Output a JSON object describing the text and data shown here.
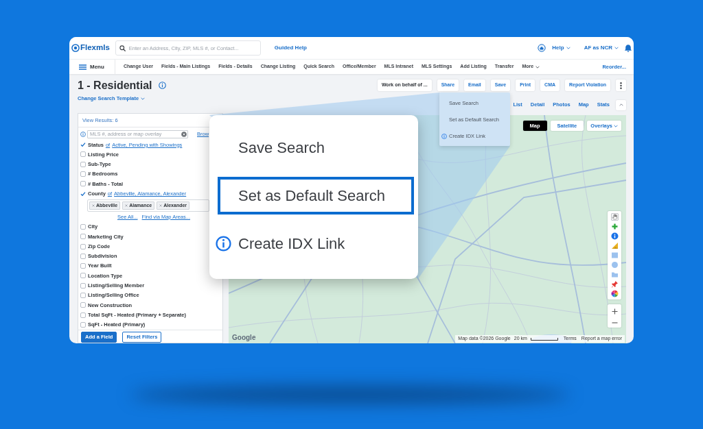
{
  "header": {
    "logo": "Flexmls",
    "search": {
      "placeholder": "Enter an Address, City, ZIP, MLS #, or Contact..."
    },
    "guided_help": "Guided Help",
    "help_menu": "Help",
    "user_menu": "AF as NCR"
  },
  "nav": {
    "menu": "Menu",
    "items": [
      {
        "label": "Change User",
        "kind": "link"
      },
      {
        "label": "Fields - Main Listings",
        "kind": "link"
      },
      {
        "label": "Fields - Details",
        "kind": "link"
      },
      {
        "label": "Change Listing",
        "kind": "link"
      },
      {
        "label": "Quick Search",
        "kind": "link"
      },
      {
        "label": "Office/Member",
        "kind": "link"
      },
      {
        "label": "MLS Intranet",
        "kind": "link"
      },
      {
        "label": "MLS Settings",
        "kind": "link"
      },
      {
        "label": "Add Listing",
        "kind": "link"
      },
      {
        "label": "Transfer",
        "kind": "link"
      },
      {
        "label": "More",
        "kind": "dropdown"
      }
    ],
    "reorder": "Reorder..."
  },
  "page": {
    "title": "1 - Residential",
    "template_link": "Change Search Template"
  },
  "toolbar": [
    {
      "label": "Work on behalf of ...",
      "kind": "neutral"
    },
    {
      "label": "Share",
      "kind": "action"
    },
    {
      "label": "Email",
      "kind": "action"
    },
    {
      "label": "Save",
      "kind": "action"
    },
    {
      "label": "Print",
      "kind": "action"
    },
    {
      "label": "CMA",
      "kind": "action"
    },
    {
      "label": "Report Violation",
      "kind": "action"
    }
  ],
  "view_tabs": [
    "List",
    "Detail",
    "Photos",
    "Map",
    "Stats"
  ],
  "dropdown_menu": [
    {
      "label": "Save Search",
      "kind": "plain"
    },
    {
      "label": "Set as Default Search",
      "kind": "plain"
    },
    {
      "label": "Create IDX Link",
      "kind": "info"
    }
  ],
  "filters": {
    "results": "View Results: 6",
    "search": {
      "placeholder": "MLS #, address or map overlay"
    },
    "browse_link": "Brow",
    "fields": [
      {
        "label": "Status",
        "checked": true,
        "qualifier": "of",
        "value": "Active, Pending with Showings"
      },
      {
        "label": "Listing Price",
        "checked": false
      },
      {
        "label": "Sub-Type",
        "checked": false
      },
      {
        "label": "# Bedrooms",
        "checked": false
      },
      {
        "label": "# Baths - Total",
        "checked": false
      },
      {
        "label": "County",
        "checked": true,
        "qualifier": "of",
        "value": "Abbeville, Alamance, Alexander",
        "chips": [
          "Abbeville",
          "Alamance",
          "Alexander"
        ],
        "links": [
          "See All...",
          "Find via Map Areas..."
        ]
      },
      {
        "label": "City",
        "checked": false
      },
      {
        "label": "Marketing City",
        "checked": false
      },
      {
        "label": "Zip Code",
        "checked": false
      },
      {
        "label": "Subdivision",
        "checked": false
      },
      {
        "label": "Year Built",
        "checked": false
      },
      {
        "label": "Location Type",
        "checked": false
      },
      {
        "label": "Listing/Selling Member",
        "checked": false
      },
      {
        "label": "Listing/Selling Office",
        "checked": false
      },
      {
        "label": "New Construction",
        "checked": false
      },
      {
        "label": "Total SqFt - Heated (Primary + Separate)",
        "checked": false
      },
      {
        "label": "SqFt - Heated (Primary)",
        "checked": false
      }
    ],
    "buttons": [
      {
        "label": "Add a Field",
        "kind": "primary"
      },
      {
        "label": "Reset Filters",
        "kind": "outline"
      }
    ]
  },
  "map": {
    "types": [
      {
        "label": "Map",
        "selected": true
      },
      {
        "label": "Satellite",
        "selected": false
      }
    ],
    "overlays": "Overlays",
    "logo": "Google",
    "attribution": "Map data ©2026 Google",
    "scale": "20 km",
    "terms": "Terms",
    "report": "Report a map error"
  },
  "callout": [
    {
      "label": "Save Search",
      "kind": "plain",
      "highlighted": false
    },
    {
      "label": "Set as Default Search",
      "kind": "plain",
      "highlighted": true
    },
    {
      "label": "Create IDX Link",
      "kind": "info",
      "highlighted": false
    }
  ]
}
